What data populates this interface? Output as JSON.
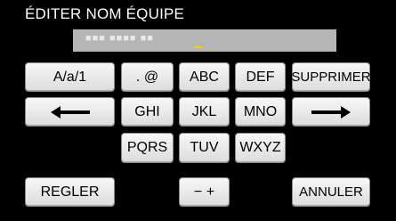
{
  "title": "ÉDITER NOM ÉQUIPE",
  "entry": {
    "value": "■■■ ■■■■ ■■"
  },
  "keys": {
    "mode": "A/a/1",
    "punct": ". @",
    "abc": "ABC",
    "def": "DEF",
    "delete": "SUPPRIMER",
    "ghi": "GHI",
    "jkl": "JKL",
    "mno": "MNO",
    "pqrs": "PQRS",
    "tuv": "TUV",
    "wxyz": "WXYZ",
    "set": "REGLER",
    "minus_plus": "− +",
    "cancel": "ANNULER"
  },
  "icons": {
    "left": "left-arrow-icon",
    "right": "right-arrow-icon"
  },
  "colors": {
    "background": "#000000",
    "cursor": "#f5d000",
    "entry_field": "#b5b5b5"
  }
}
